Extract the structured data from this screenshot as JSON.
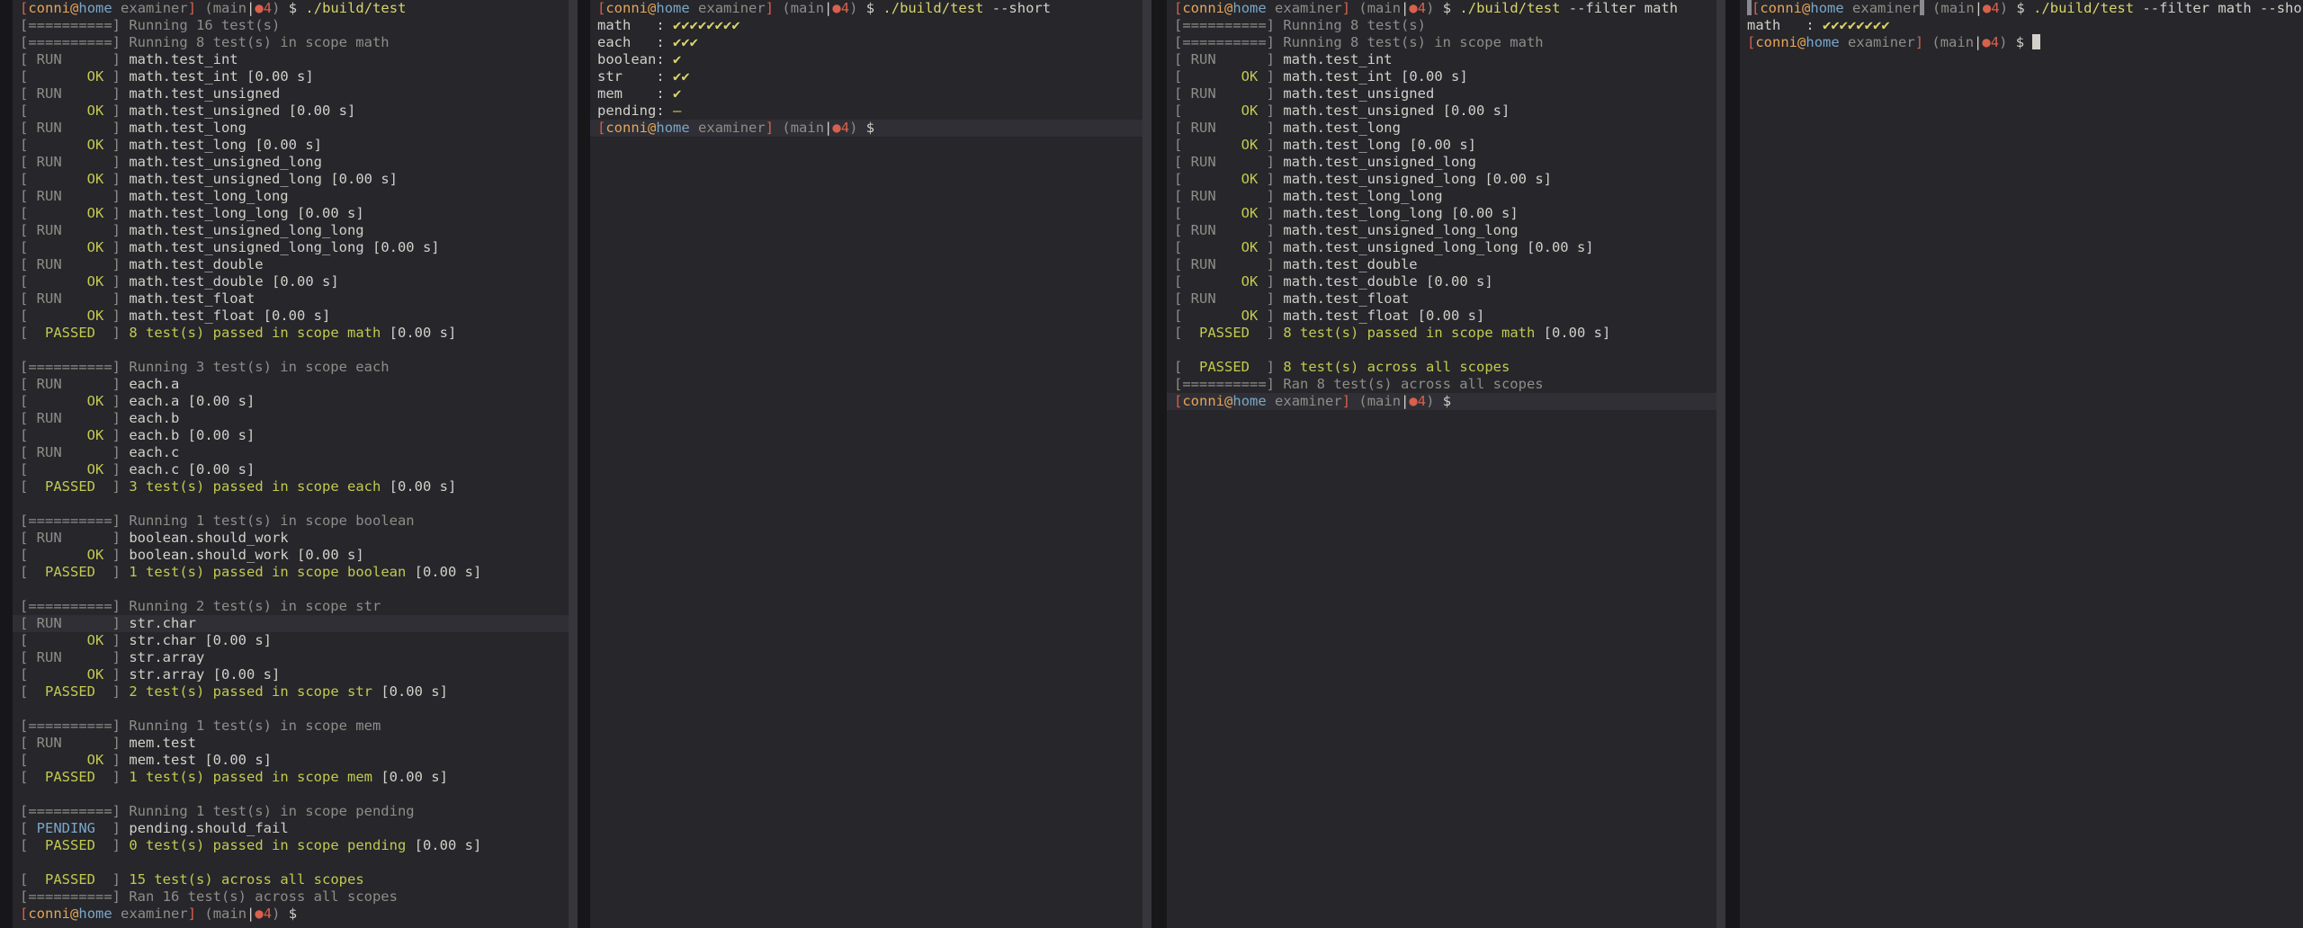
{
  "prompt": {
    "user": "conni",
    "at": "@",
    "host": "home",
    "dir": "examiner",
    "branch": "main",
    "dirty_dot": "●",
    "dirty_count": "4",
    "symbol": "$"
  },
  "pane1": {
    "command": "./build/test",
    "lines": [
      [
        "[==========]",
        "Running 16 test(s)",
        ""
      ],
      [
        "[==========]",
        "Running 8 test(s) in scope math",
        ""
      ],
      [
        "[ RUN      ]",
        "math.test_int",
        ""
      ],
      [
        "[       OK ]",
        "math.test_int [0.00 s]",
        ""
      ],
      [
        "[ RUN      ]",
        "math.test_unsigned",
        ""
      ],
      [
        "[       OK ]",
        "math.test_unsigned [0.00 s]",
        ""
      ],
      [
        "[ RUN      ]",
        "math.test_long",
        ""
      ],
      [
        "[       OK ]",
        "math.test_long [0.00 s]",
        ""
      ],
      [
        "[ RUN      ]",
        "math.test_unsigned_long",
        ""
      ],
      [
        "[       OK ]",
        "math.test_unsigned_long [0.00 s]",
        ""
      ],
      [
        "[ RUN      ]",
        "math.test_long_long",
        ""
      ],
      [
        "[       OK ]",
        "math.test_long_long [0.00 s]",
        ""
      ],
      [
        "[ RUN      ]",
        "math.test_unsigned_long_long",
        ""
      ],
      [
        "[       OK ]",
        "math.test_unsigned_long_long [0.00 s]",
        ""
      ],
      [
        "[ RUN      ]",
        "math.test_double",
        ""
      ],
      [
        "[       OK ]",
        "math.test_double [0.00 s]",
        ""
      ],
      [
        "[ RUN      ]",
        "math.test_float",
        ""
      ],
      [
        "[       OK ]",
        "math.test_float [0.00 s]",
        ""
      ],
      [
        "[  PASSED  ]",
        "8 test(s) passed in scope math",
        " [0.00 s]"
      ],
      [
        "",
        "",
        ""
      ],
      [
        "[==========]",
        "Running 3 test(s) in scope each",
        ""
      ],
      [
        "[ RUN      ]",
        "each.a",
        ""
      ],
      [
        "[       OK ]",
        "each.a [0.00 s]",
        ""
      ],
      [
        "[ RUN      ]",
        "each.b",
        ""
      ],
      [
        "[       OK ]",
        "each.b [0.00 s]",
        ""
      ],
      [
        "[ RUN      ]",
        "each.c",
        ""
      ],
      [
        "[       OK ]",
        "each.c [0.00 s]",
        ""
      ],
      [
        "[  PASSED  ]",
        "3 test(s) passed in scope each",
        " [0.00 s]"
      ],
      [
        "",
        "",
        ""
      ],
      [
        "[==========]",
        "Running 1 test(s) in scope boolean",
        ""
      ],
      [
        "[ RUN      ]",
        "boolean.should_work",
        ""
      ],
      [
        "[       OK ]",
        "boolean.should_work [0.00 s]",
        ""
      ],
      [
        "[  PASSED  ]",
        "1 test(s) passed in scope boolean",
        " [0.00 s]"
      ],
      [
        "",
        "",
        ""
      ],
      [
        "[==========]",
        "Running 2 test(s) in scope str",
        ""
      ],
      [
        "[ RUN      ]",
        "str.char",
        ""
      ],
      [
        "[       OK ]",
        "str.char [0.00 s]",
        ""
      ],
      [
        "[ RUN      ]",
        "str.array",
        ""
      ],
      [
        "[       OK ]",
        "str.array [0.00 s]",
        ""
      ],
      [
        "[  PASSED  ]",
        "2 test(s) passed in scope str",
        " [0.00 s]"
      ],
      [
        "",
        "",
        ""
      ],
      [
        "[==========]",
        "Running 1 test(s) in scope mem",
        ""
      ],
      [
        "[ RUN      ]",
        "mem.test",
        ""
      ],
      [
        "[       OK ]",
        "mem.test [0.00 s]",
        ""
      ],
      [
        "[  PASSED  ]",
        "1 test(s) passed in scope mem",
        " [0.00 s]"
      ],
      [
        "",
        "",
        ""
      ],
      [
        "[==========]",
        "Running 1 test(s) in scope pending",
        ""
      ],
      [
        "[ PENDING  ]",
        "pending.should_fail",
        ""
      ],
      [
        "[  PASSED  ]",
        "0 test(s) passed in scope pending",
        " [0.00 s]"
      ],
      [
        "",
        "",
        ""
      ],
      [
        "[  PASSED  ]",
        "15 test(s) across all scopes",
        ""
      ],
      [
        "[==========]",
        "Ran 16 test(s) across all scopes",
        ""
      ]
    ]
  },
  "pane2": {
    "command": "./build/test",
    "args": "--short",
    "rows": [
      [
        "math   : ",
        "✔✔✔✔✔✔✔✔"
      ],
      [
        "each   : ",
        "✔✔✔"
      ],
      [
        "boolean: ",
        "✔"
      ],
      [
        "str    : ",
        "✔✔"
      ],
      [
        "mem    : ",
        "✔"
      ],
      [
        "pending: ",
        "–"
      ]
    ]
  },
  "pane3": {
    "command": "./build/test",
    "args": "--filter math",
    "lines": [
      [
        "[==========]",
        "Running 8 test(s)",
        ""
      ],
      [
        "[==========]",
        "Running 8 test(s) in scope math",
        ""
      ],
      [
        "[ RUN      ]",
        "math.test_int",
        ""
      ],
      [
        "[       OK ]",
        "math.test_int [0.00 s]",
        ""
      ],
      [
        "[ RUN      ]",
        "math.test_unsigned",
        ""
      ],
      [
        "[       OK ]",
        "math.test_unsigned [0.00 s]",
        ""
      ],
      [
        "[ RUN      ]",
        "math.test_long",
        ""
      ],
      [
        "[       OK ]",
        "math.test_long [0.00 s]",
        ""
      ],
      [
        "[ RUN      ]",
        "math.test_unsigned_long",
        ""
      ],
      [
        "[       OK ]",
        "math.test_unsigned_long [0.00 s]",
        ""
      ],
      [
        "[ RUN      ]",
        "math.test_long_long",
        ""
      ],
      [
        "[       OK ]",
        "math.test_long_long [0.00 s]",
        ""
      ],
      [
        "[ RUN      ]",
        "math.test_unsigned_long_long",
        ""
      ],
      [
        "[       OK ]",
        "math.test_unsigned_long_long [0.00 s]",
        ""
      ],
      [
        "[ RUN      ]",
        "math.test_double",
        ""
      ],
      [
        "[       OK ]",
        "math.test_double [0.00 s]",
        ""
      ],
      [
        "[ RUN      ]",
        "math.test_float",
        ""
      ],
      [
        "[       OK ]",
        "math.test_float [0.00 s]",
        ""
      ],
      [
        "[  PASSED  ]",
        "8 test(s) passed in scope math",
        " [0.00 s]"
      ],
      [
        "",
        "",
        ""
      ],
      [
        "[  PASSED  ]",
        "8 test(s) across all scopes",
        ""
      ],
      [
        "[==========]",
        "Ran 8 test(s) across all scopes",
        ""
      ]
    ]
  },
  "pane4": {
    "command": "./build/test",
    "args": "--filter math --short",
    "rows": [
      [
        "math   : ",
        "✔✔✔✔✔✔✔✔"
      ]
    ]
  }
}
